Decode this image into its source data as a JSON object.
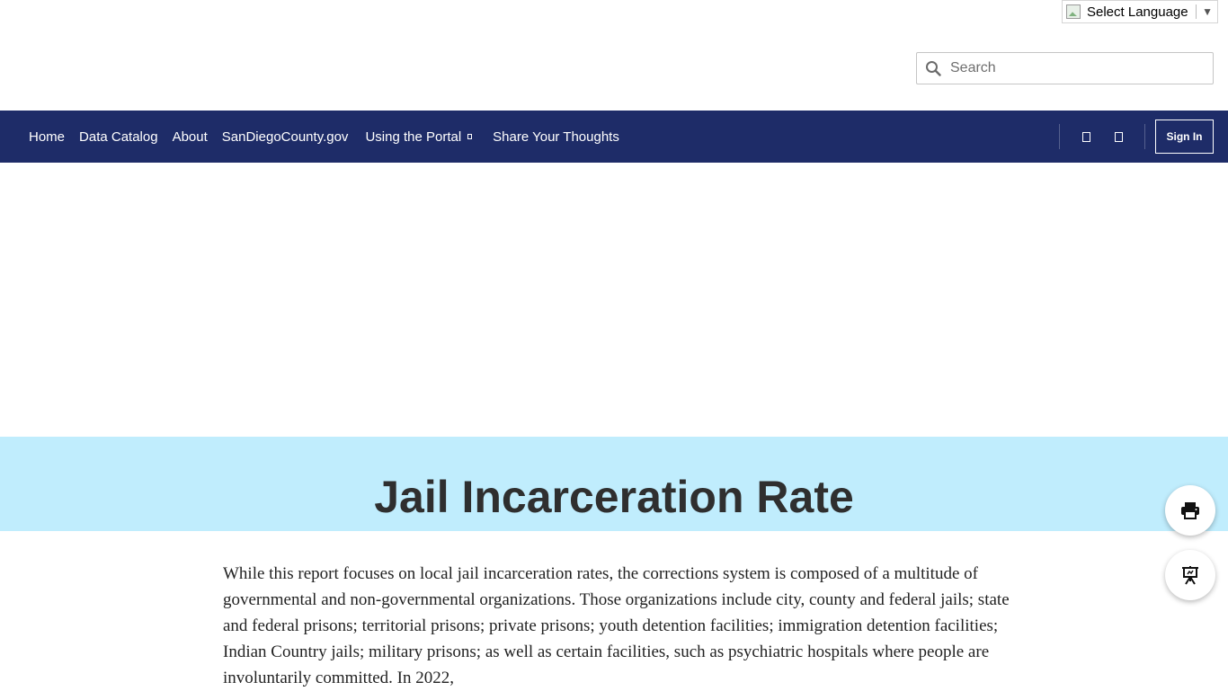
{
  "language": {
    "label": "Select Language",
    "arrow": "▼"
  },
  "search": {
    "placeholder": "Search",
    "value": ""
  },
  "nav": {
    "links": [
      {
        "label": "Home"
      },
      {
        "label": "Data Catalog"
      },
      {
        "label": "About"
      },
      {
        "label": "SanDiegoCounty.gov"
      },
      {
        "label": "Using the Portal"
      },
      {
        "label": "Share Your Thoughts"
      }
    ],
    "sign_in": "Sign In"
  },
  "hero": {
    "title": "Jail Incarceration Rate"
  },
  "content": {
    "paragraph": "While this report focuses on local jail incarceration rates, the corrections system is composed of a multitude of governmental and non-governmental organizations. Those organizations include city, county and federal jails; state and federal prisons; territorial prisons; private prisons; youth detention facilities; immigration detention facilities; Indian Country jails; military prisons; as well as certain facilities, such as psychiatric hospitals where people are involuntarily committed. In 2022,"
  },
  "colors": {
    "nav_bg": "#1e2c68",
    "hero_bg": "#c0edfd"
  },
  "icons": {
    "search": "search-icon",
    "print": "print-icon",
    "presentation": "presentation-icon"
  }
}
